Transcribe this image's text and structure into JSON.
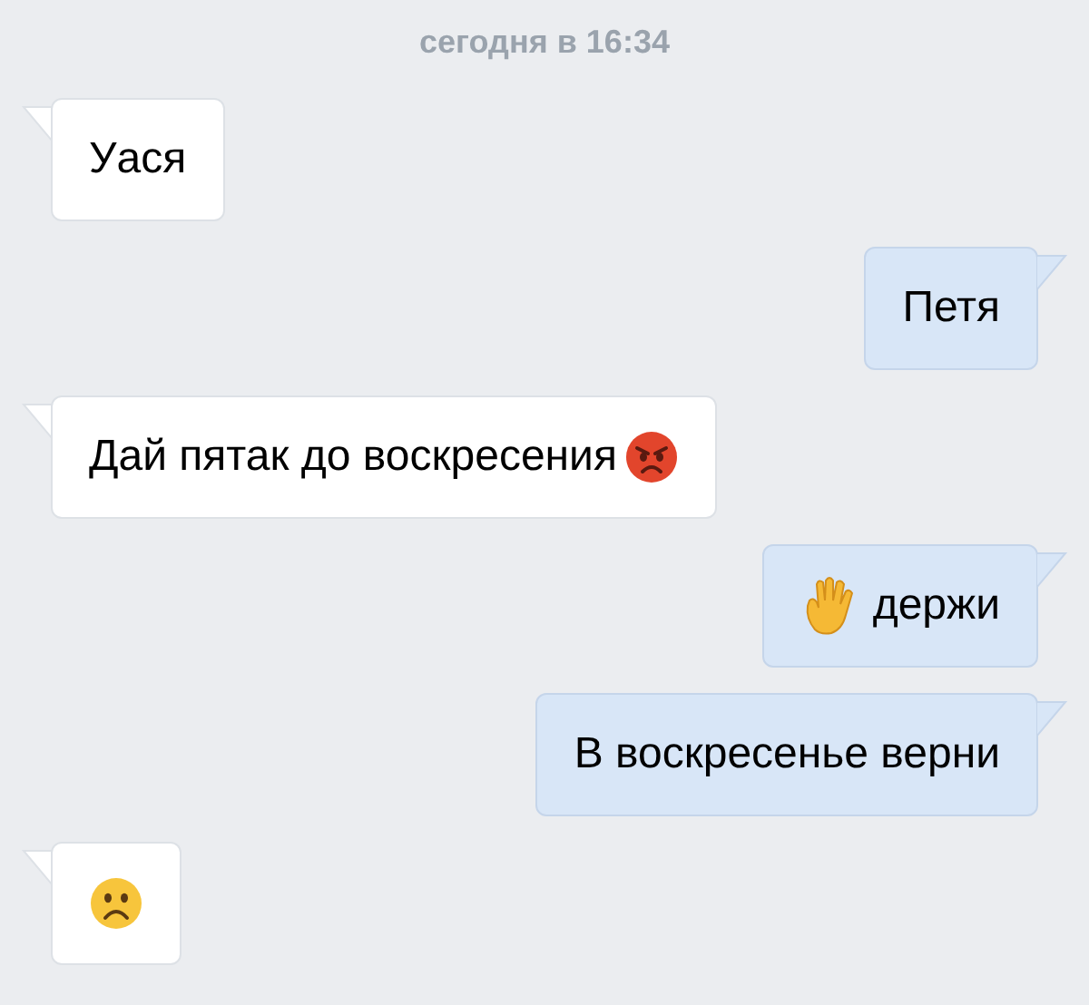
{
  "date_header": "сегодня в 16:34",
  "messages": [
    {
      "kind": "incoming",
      "parts": [
        {
          "kind": "text",
          "text": "Уася"
        }
      ]
    },
    {
      "kind": "outgoing",
      "parts": [
        {
          "kind": "text",
          "text": "Петя"
        }
      ]
    },
    {
      "kind": "incoming",
      "parts": [
        {
          "kind": "text",
          "text": "Дай пятак до воскресения"
        },
        {
          "kind": "angry"
        }
      ]
    },
    {
      "kind": "outgoing",
      "parts": [
        {
          "kind": "hand"
        },
        {
          "kind": "text",
          "text": "держи"
        }
      ]
    },
    {
      "kind": "outgoing",
      "parts": [
        {
          "kind": "text",
          "text": "В воскресенье верни"
        }
      ]
    },
    {
      "kind": "incoming",
      "parts": [
        {
          "kind": "sad"
        }
      ]
    }
  ]
}
